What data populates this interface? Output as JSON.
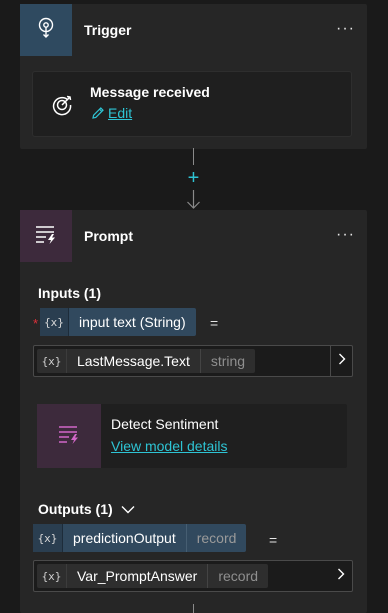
{
  "trigger": {
    "title": "Trigger",
    "more_label": "···",
    "event": {
      "label": "Message received",
      "edit_label": "Edit"
    }
  },
  "connector": {
    "add_label": "+"
  },
  "prompt": {
    "title": "Prompt",
    "more_label": "···",
    "inputs": {
      "label": "Inputs (1)",
      "required_mark": "*",
      "variable": {
        "icon_label": "{x}",
        "name": "input text (String)",
        "equals": "="
      },
      "value": {
        "icon_label": "{x}",
        "name": "LastMessage.Text",
        "type": "string"
      }
    },
    "model": {
      "name": "Detect Sentiment",
      "link_label": "View model details"
    },
    "outputs": {
      "label": "Outputs (1)",
      "variable": {
        "icon_label": "{x}",
        "name": "predictionOutput",
        "type": "record",
        "equals": "="
      },
      "value": {
        "icon_label": "{x}",
        "name": "Var_PromptAnswer",
        "type": "record"
      }
    }
  },
  "colors": {
    "accent": "#2ec4d4",
    "trigger_tile": "#2f4a60",
    "prompt_tile": "#3d2a3c",
    "token_bg": "#31495e",
    "required": "#e0303a"
  }
}
